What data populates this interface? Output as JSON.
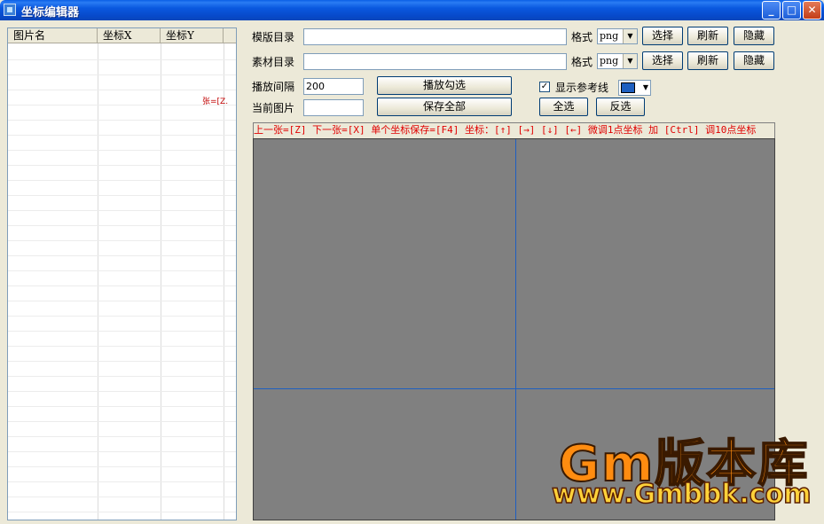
{
  "window": {
    "title": "坐标编辑器"
  },
  "window_buttons": {
    "minimize": "_",
    "maximize": "□",
    "close": "✕"
  },
  "list": {
    "columns": [
      "图片名",
      "坐标X",
      "坐标Y"
    ],
    "cell_note": "张=[Z."
  },
  "form": {
    "template_dir_label": "模版目录",
    "material_dir_label": "素材目录",
    "format_label": "格式",
    "format_value_1": "png",
    "format_value_2": "png",
    "select_button": "选择",
    "refresh_button": "刷新",
    "hide_button": "隐藏",
    "interval_label": "播放间隔",
    "interval_value": "200",
    "current_label": "当前图片",
    "current_value": "",
    "play_checked_button": "播放勾选",
    "save_all_button": "保存全部",
    "show_ref_label": "显示参考线",
    "show_ref_checked": "✓",
    "ref_color": "#1e5fc0",
    "select_all_button": "全选",
    "invert_button": "反选"
  },
  "hint": "上一张=[Z] 下一张=[X] 单个坐标保存=[F4] 坐标：[↑] [→] [↓] [←] 微调1点坐标 加 [Ctrl] 调10点坐标",
  "watermark": {
    "line1": "Gm版本库",
    "line2": "www.Gmbbk.com"
  }
}
